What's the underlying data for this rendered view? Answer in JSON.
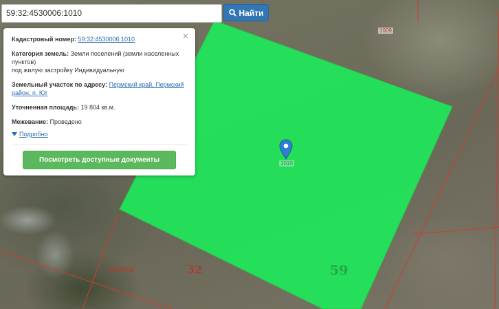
{
  "search": {
    "value": "59:32:4530006:1010",
    "button_label": "Найти"
  },
  "popup": {
    "cadastral_label": "Кадастровый номер:",
    "cadastral_value": "59:32:4530006:1010",
    "category_label": "Категория земель:",
    "category_value": "Земли поселений (земли населенных пунктов)",
    "category_use": "под жилую застройку Индивидуальную",
    "address_label": "Земельный участок по адресу:",
    "address_value": "Пермский край, Пермский район, п. Юг",
    "area_label": "Уточненная площадь:",
    "area_value": "19 804 кв.м.",
    "survey_label": "Межевание:",
    "survey_value": "Проведено",
    "more_label": "Подробно",
    "docs_button_label": "Посмотреть доступные документы"
  },
  "map": {
    "parcel_color": "#1ee85a",
    "boundary_color": "#d23a2e",
    "label_1009": "1009",
    "label_1010": "1010",
    "label_quarter": "4530006",
    "label_district": "32",
    "label_region": "59"
  }
}
